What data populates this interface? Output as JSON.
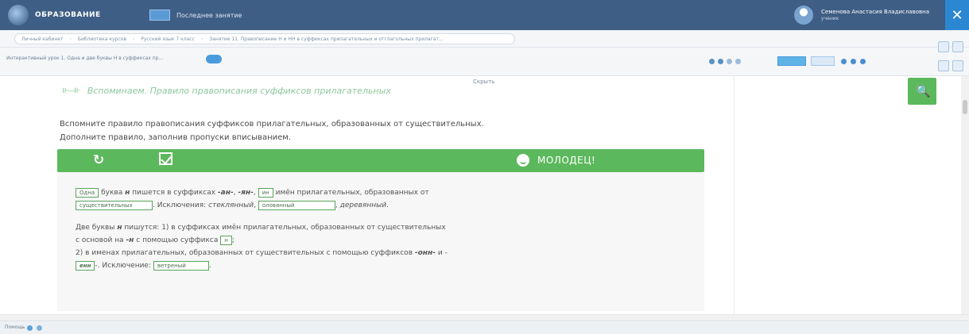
{
  "header": {
    "logo_text": "ОБРАЗОВАНИЕ",
    "last_lesson": "Последнее занятие",
    "user_name": "Семенова Анастасия Владиславовна",
    "user_role": "ученик",
    "close": "✕"
  },
  "breadcrumb": [
    "Личный кабинет",
    "Библиотека курсов",
    "Русский язык 7 класс",
    "Занятие 11. Правописание Н и НН в суффиксах прилагательных и отглагольных прилагат..."
  ],
  "toolbar": {
    "interactive_label": "Интерактивный урок 1. Одна и две буквы Н в суффиксах пр..."
  },
  "content": {
    "hide_link": "Скрыть",
    "section_icon": "⊪—⊪",
    "section_title": "Вспоминаем. Правило правописания суффиксов прилагательных",
    "instruction_1": "Вспомните правило правописания суффиксов прилагательных, образованных от существительных.",
    "instruction_2": "Дополните правило, заполнив пропуски вписыванием.",
    "well_done": "МОЛОДЕЦ!",
    "refresh_icon": "↻",
    "p1": {
      "blank_one": "Одна",
      "t1": "буква ",
      "n": "н",
      "t2": " пишется в суффиксах ",
      "s1": "-ан-",
      "c1": ", ",
      "s2": "-ян-",
      "c2": ", ",
      "blank_in": "ин",
      "t3": " имён прилагательных, образованных от",
      "blank_nouns": "существительных",
      "t4": ". Исключения: ",
      "exc1": "стеклянный",
      "c3": ", ",
      "blank_oloviannyi": "оловянный",
      "c4": ", ",
      "exc3": "деревянный",
      "end": "."
    },
    "p2": {
      "t1": "Две буквы ",
      "n": "н",
      "t2": " пишутся: 1) в суффиксах имён прилагательных, образованных от существительных",
      "t3": "с основой на ",
      "suf_n": "-н",
      "t4": " с помощью суффикса ",
      "blank_n": "н",
      "t5": ";",
      "t6": "2) в именах прилагательных, образованных от существительных с помощью суффиксов ",
      "suf_onn": "-онн-",
      "t7": " и -",
      "blank_enn": "енн",
      "t8": "-. Исключение: ",
      "blank_vetrenyi": "ветреный",
      "end": "."
    },
    "key_icon": "🔍"
  },
  "status": {
    "help": "Помощь"
  }
}
